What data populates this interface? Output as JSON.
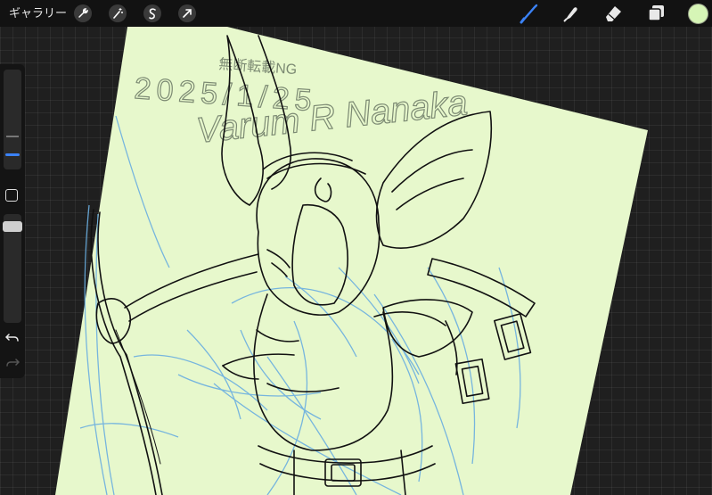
{
  "topbar": {
    "gallery_label": "ギャラリー",
    "left_tools": [
      "wrench-icon",
      "magic-wand-icon",
      "selection-icon",
      "transform-arrow-icon"
    ],
    "right_tools": [
      "brush-icon",
      "smudge-icon",
      "eraser-icon",
      "layers-icon"
    ],
    "active_tool": "brush-icon",
    "current_color": "#d6f5b6"
  },
  "sidebar": {
    "controls": [
      "brush-size-slider",
      "modify-button",
      "opacity-slider",
      "undo-button",
      "redo-button"
    ]
  },
  "canvas": {
    "paper_color": "#e7f8cc",
    "sketch_color": "#6aaee0",
    "ink_color": "#111111",
    "signature_lines": [
      "無断転載NG",
      "2025/1/25",
      "Varum R Nanaka"
    ]
  },
  "colors": {
    "toolbar_bg": "#121212",
    "workspace_bg": "#1f1f1f",
    "accent_blue": "#3b82f6"
  }
}
